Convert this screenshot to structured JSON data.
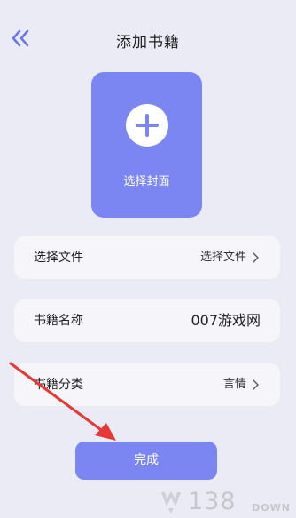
{
  "header": {
    "title": "添加书籍",
    "back_icon": "double-chevron-left-icon"
  },
  "cover": {
    "label": "选择封面",
    "icon": "plus-circle-icon"
  },
  "rows": [
    {
      "label": "选择文件",
      "value": "选择文件",
      "icon": "chevron-right-icon"
    },
    {
      "label": "书籍名称",
      "value": "007游戏网"
    },
    {
      "label": "书籍分类",
      "value": "言情",
      "icon": "chevron-right-icon"
    }
  ],
  "done_button": {
    "label": "完成"
  },
  "watermark": {
    "number": "138",
    "sub": "DOWN"
  },
  "colors": {
    "accent": "#7b86f2",
    "background": "#ebebf6",
    "card": "#f5f5fa",
    "arrow": "#e53935"
  }
}
